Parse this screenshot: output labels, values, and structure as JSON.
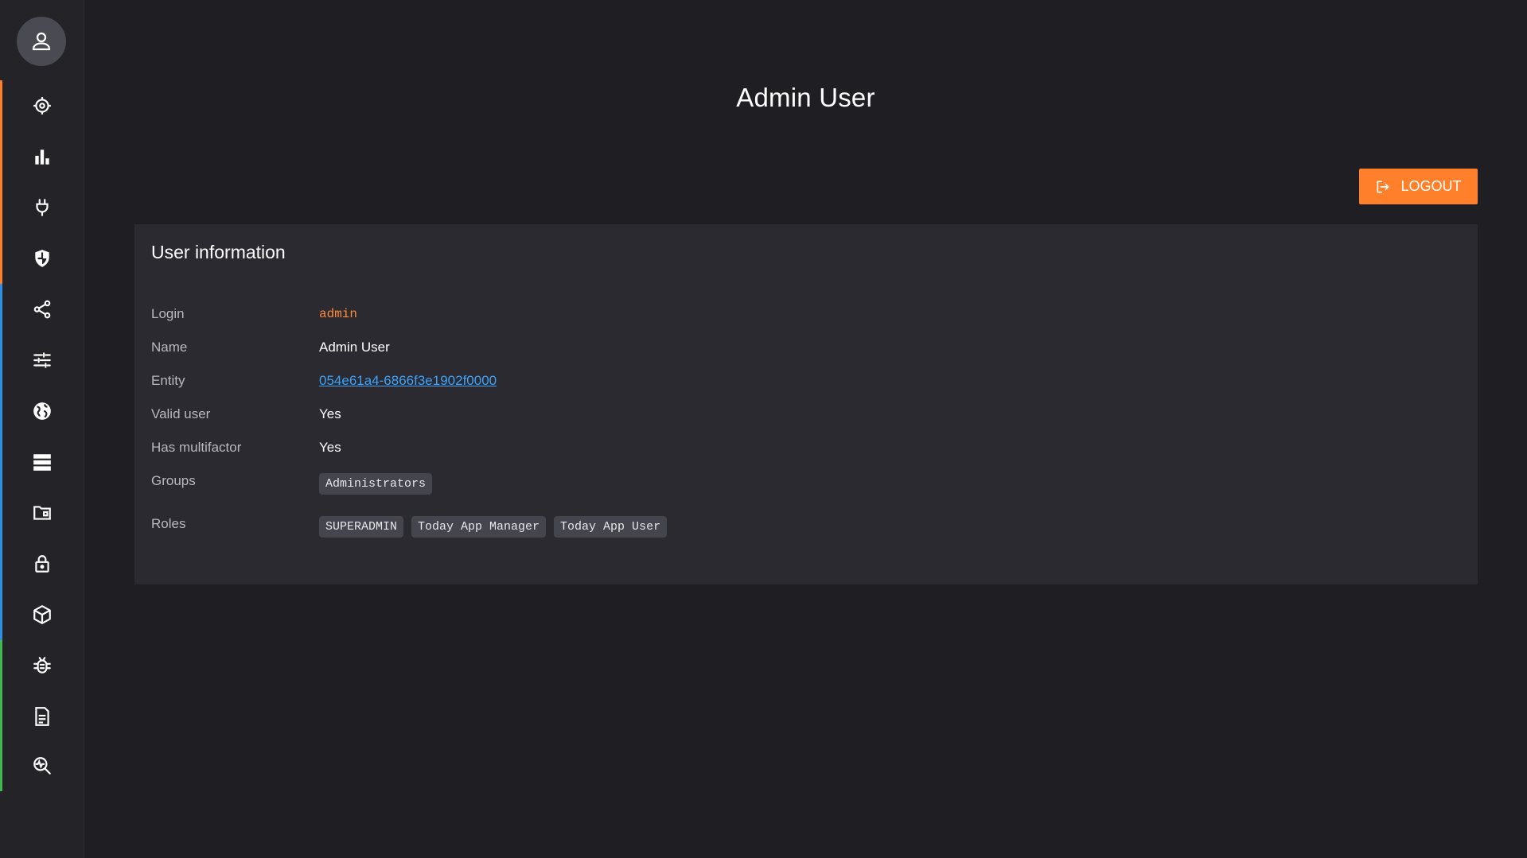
{
  "sidebar": {
    "avatar_icon": "user-icon",
    "items": [
      {
        "icon": "target-icon",
        "color": "#ff7f2a"
      },
      {
        "icon": "bar-chart-icon",
        "color": "#ff7f2a"
      },
      {
        "icon": "plug-icon",
        "color": "#ff7f2a"
      },
      {
        "icon": "shield-icon",
        "color": "#ff7f2a"
      },
      {
        "icon": "share-icon",
        "color": "#2f8fe3"
      },
      {
        "icon": "sliders-icon",
        "color": "#2f8fe3"
      },
      {
        "icon": "globe-icon",
        "color": "#2f8fe3"
      },
      {
        "icon": "server-icon",
        "color": "#2f8fe3"
      },
      {
        "icon": "folder-icon",
        "color": "#2f8fe3"
      },
      {
        "icon": "lock-icon",
        "color": "#2f8fe3"
      },
      {
        "icon": "cube-icon",
        "color": "#2f8fe3"
      },
      {
        "icon": "bug-icon",
        "color": "#3fb950"
      },
      {
        "icon": "document-icon",
        "color": "#3fb950"
      },
      {
        "icon": "monitor-search-icon",
        "color": "#3fb950"
      }
    ]
  },
  "header": {
    "title": "Admin User",
    "logout_label": "LOGOUT",
    "logout_icon": "logout-icon",
    "accent": "#ff7f2a"
  },
  "card": {
    "title": "User information",
    "fields": {
      "login": {
        "label": "Login",
        "value": "admin"
      },
      "name": {
        "label": "Name",
        "value": "Admin User"
      },
      "entity": {
        "label": "Entity",
        "value": "054e61a4-6866f3e1902f0000"
      },
      "valid": {
        "label": "Valid user",
        "value": "Yes"
      },
      "multifactor": {
        "label": "Has multifactor",
        "value": "Yes"
      },
      "groups": {
        "label": "Groups",
        "values": [
          "Administrators"
        ]
      },
      "roles": {
        "label": "Roles",
        "values": [
          "SUPERADMIN",
          "Today App Manager",
          "Today App User"
        ]
      }
    }
  }
}
